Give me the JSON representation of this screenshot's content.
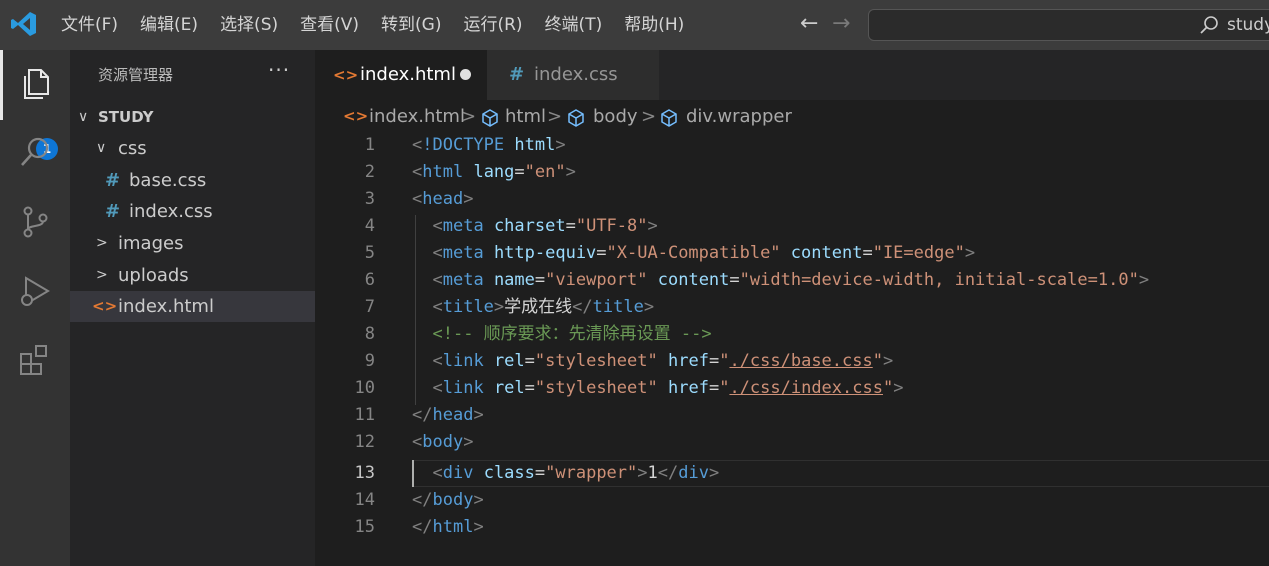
{
  "menu": [
    "文件(F)",
    "编辑(E)",
    "选择(S)",
    "查看(V)",
    "转到(G)",
    "运行(R)",
    "终端(T)",
    "帮助(H)"
  ],
  "search": {
    "text": "study"
  },
  "colors": {
    "accent": "#0e76d6",
    "titlebar": "#3c3c3c",
    "editor_bg": "#1e1e1e"
  },
  "activity_bar": {
    "icons": [
      "explorer-icon",
      "search-icon",
      "source-control-icon",
      "run-debug-icon",
      "extensions-icon"
    ],
    "badge": "1"
  },
  "sidebar": {
    "title": "资源管理器",
    "more": "···",
    "root": "STUDY",
    "items": [
      {
        "label": "css",
        "kind": "folder-open"
      },
      {
        "label": "base.css",
        "kind": "css"
      },
      {
        "label": "index.css",
        "kind": "css"
      },
      {
        "label": "images",
        "kind": "folder"
      },
      {
        "label": "uploads",
        "kind": "folder"
      },
      {
        "label": "index.html",
        "kind": "html"
      }
    ]
  },
  "tabs": [
    {
      "label": "index.html",
      "modified": true
    },
    {
      "label": "index.css",
      "modified": false
    }
  ],
  "breadcrumb": [
    "index.html",
    "html",
    "body",
    "div.wrapper"
  ],
  "editor": {
    "current_line": "13",
    "line_numbers": [
      "1",
      "2",
      "3",
      "4",
      "5",
      "6",
      "7",
      "8",
      "9",
      "10",
      "11",
      "12",
      "13",
      "14",
      "15"
    ]
  }
}
